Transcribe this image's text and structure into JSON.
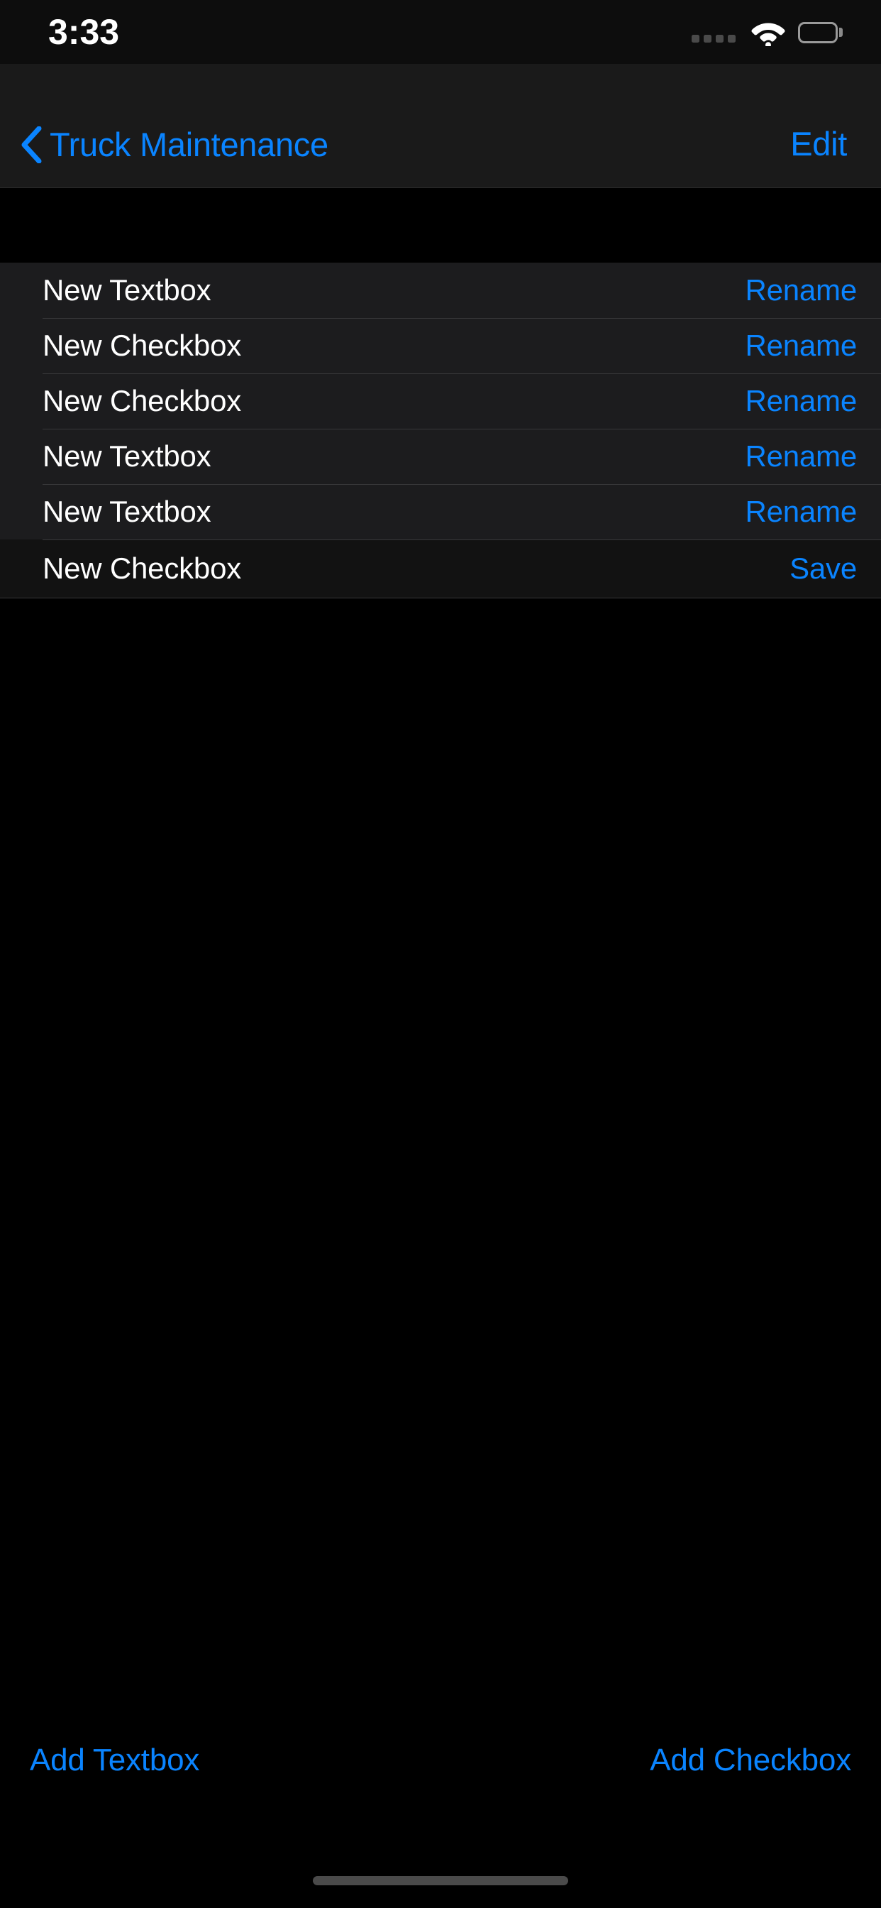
{
  "status_bar": {
    "time": "3:33",
    "cellular_icon": "cellular-dots-icon",
    "wifi_icon": "wifi-icon",
    "battery_icon": "battery-full-icon"
  },
  "nav_bar": {
    "back_icon": "chevron-left-icon",
    "back_label": "Truck Maintenance",
    "edit_label": "Edit"
  },
  "list": {
    "rows": [
      {
        "title": "New Textbox",
        "action": "Rename"
      },
      {
        "title": "New Checkbox",
        "action": "Rename"
      },
      {
        "title": "New Checkbox",
        "action": "Rename"
      },
      {
        "title": "New Textbox",
        "action": "Rename"
      },
      {
        "title": "New Textbox",
        "action": "Rename"
      },
      {
        "title": "New Checkbox",
        "action": "Save"
      }
    ]
  },
  "toolbar": {
    "add_textbox_label": "Add Textbox",
    "add_checkbox_label": "Add Checkbox"
  },
  "colors": {
    "accent_blue": "#0A84FF",
    "row_background": "#1C1C1E",
    "row_background_active": "#121212",
    "separator": "#38383A",
    "page_background": "#000000",
    "nav_background": "#1A1A1A",
    "text_primary": "#FFFFFF",
    "home_indicator": "#4A4A4A"
  }
}
